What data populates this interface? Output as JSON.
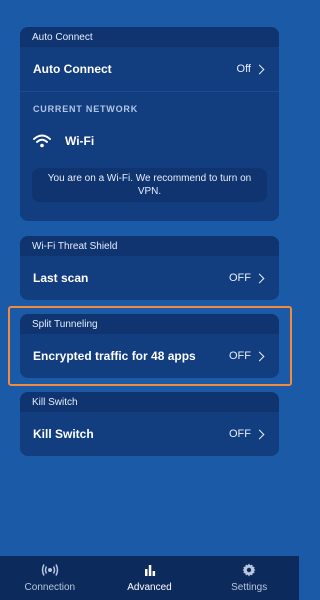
{
  "auto_connect_card": {
    "header": "Auto Connect",
    "row_label": "Auto Connect",
    "row_value": "Off",
    "section_label": "CURRENT NETWORK",
    "network_name": "Wi-Fi",
    "notice": "You are on a Wi-Fi. We recommend to turn on VPN."
  },
  "threat_shield_card": {
    "header": "Wi-Fi Threat Shield",
    "row_label": "Last scan",
    "row_value": "OFF"
  },
  "split_tunneling_card": {
    "header": "Split Tunneling",
    "row_label": "Encrypted traffic for 48 apps",
    "row_value": "OFF"
  },
  "kill_switch_card": {
    "header": "Kill Switch",
    "row_label": "Kill Switch",
    "row_value": "OFF"
  },
  "bottom_nav": {
    "items": [
      {
        "label": "Connection",
        "icon": "broadcast-icon"
      },
      {
        "label": "Advanced",
        "icon": "bar-chart-icon"
      },
      {
        "label": "Settings",
        "icon": "gear-icon"
      }
    ],
    "active": "Advanced"
  },
  "colors": {
    "background": "#1a5aa6",
    "card": "#123d7e",
    "card_header": "#0f3470",
    "nav": "#0c2a5c",
    "highlight": "#f28a3f"
  }
}
